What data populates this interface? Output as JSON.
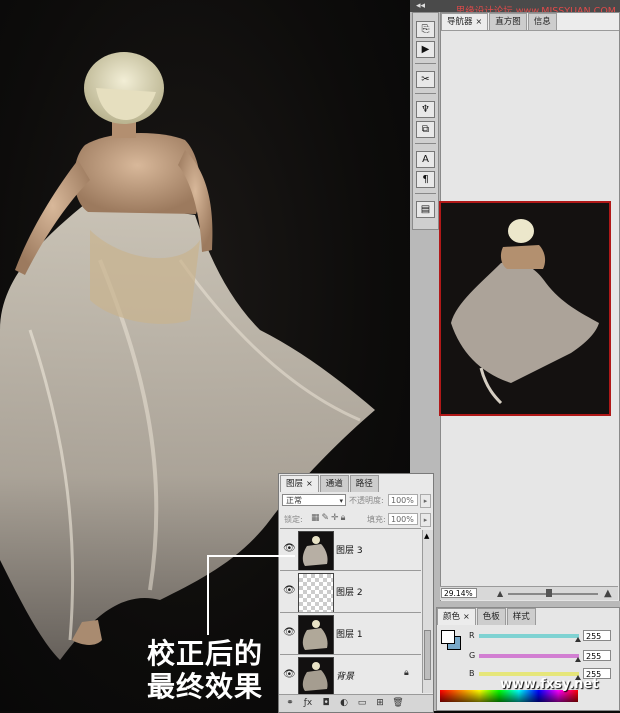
{
  "watermark": {
    "top": "思缘设计论坛 www.MISSYUAN.COM",
    "bottom": "www.fxsy.net"
  },
  "navigator": {
    "tabs": [
      "导航器",
      "直方图",
      "信息"
    ],
    "zoom": "29.14%"
  },
  "layers": {
    "tabs": [
      "图层",
      "通道",
      "路径"
    ],
    "blend_mode": "正常",
    "opacity_label": "不透明度:",
    "opacity_value": "100%",
    "lock_label": "锁定:",
    "fill_label": "填充:",
    "fill_value": "100%",
    "items": [
      {
        "name": "图层 3"
      },
      {
        "name": "图层 2"
      },
      {
        "name": "图层 1"
      },
      {
        "name": "背景"
      }
    ]
  },
  "color": {
    "tabs": [
      "颜色",
      "色板",
      "样式"
    ],
    "rows": [
      {
        "label": "R",
        "value": "255",
        "track": "#7fd2d2"
      },
      {
        "label": "G",
        "value": "255",
        "track": "#d27fd2"
      },
      {
        "label": "B",
        "value": "255",
        "track": "#e6e67a"
      }
    ]
  },
  "caption": {
    "line1": "校正后的",
    "line2": "最终效果"
  }
}
